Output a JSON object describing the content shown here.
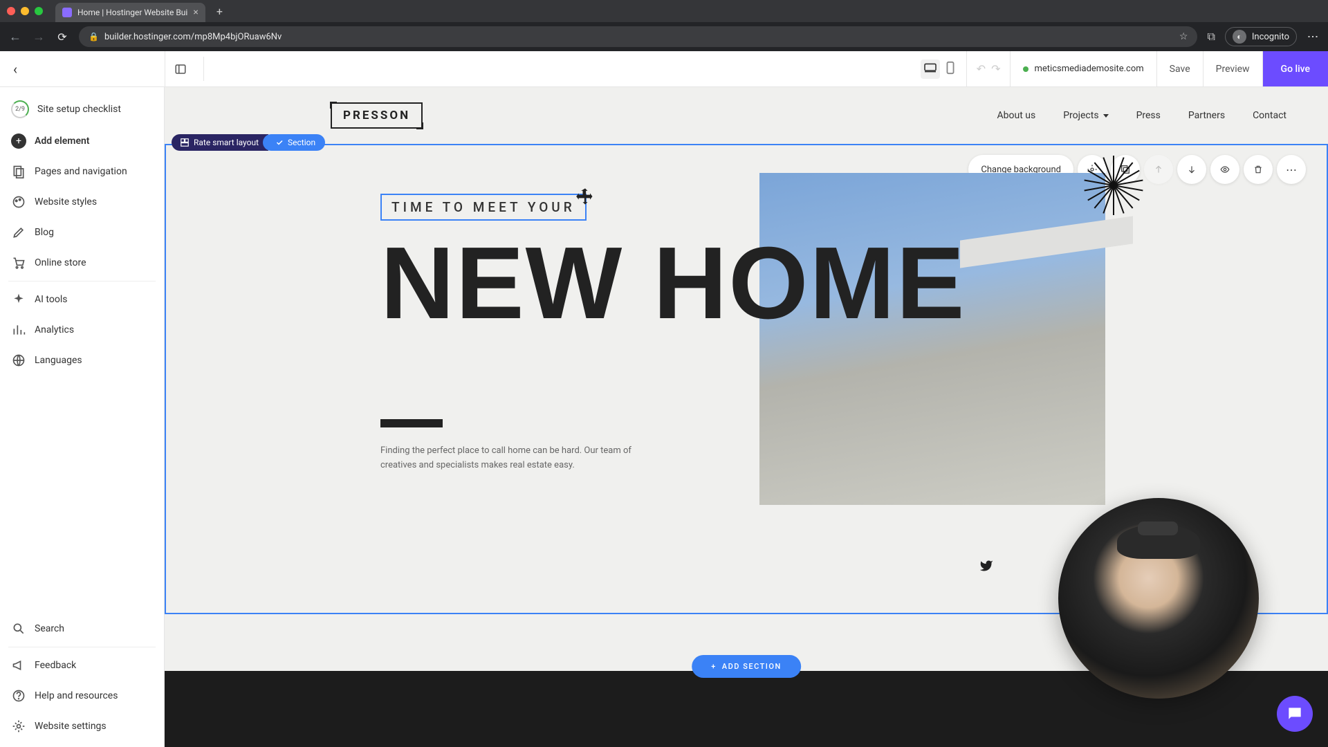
{
  "browser": {
    "tab_title": "Home | Hostinger Website Bui",
    "url": "builder.hostinger.com/mp8Mp4bjORuaw6Nv",
    "incognito_label": "Incognito"
  },
  "topbar": {
    "site_url": "meticsmediademosite.com",
    "save": "Save",
    "preview": "Preview",
    "go_live": "Go live"
  },
  "sidebar": {
    "checklist": "Site setup checklist",
    "checklist_count": "2/9",
    "add_element": "Add element",
    "pages": "Pages and navigation",
    "styles": "Website styles",
    "blog": "Blog",
    "store": "Online store",
    "ai": "AI tools",
    "analytics": "Analytics",
    "languages": "Languages",
    "search": "Search",
    "feedback": "Feedback",
    "help": "Help and resources",
    "settings": "Website settings"
  },
  "site": {
    "logo": "PRESSON",
    "menu": {
      "about": "About us",
      "projects": "Projects",
      "press": "Press",
      "partners": "Partners",
      "contact": "Contact"
    }
  },
  "hero": {
    "overline": "TIME TO MEET YOUR",
    "title": "NEW HOME",
    "body": "Finding the perfect place to call home can be hard. Our team of creatives and specialists makes real estate easy."
  },
  "section_ui": {
    "rate": "Rate smart layout",
    "section": "Section",
    "change_bg": "Change background",
    "add_section": "ADD SECTION"
  }
}
